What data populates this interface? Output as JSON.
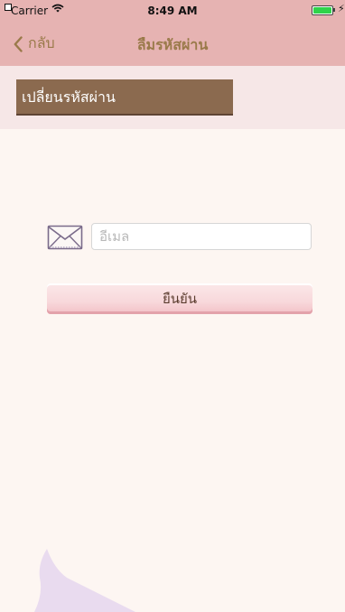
{
  "status_bar": {
    "carrier": "Carrier",
    "time": "8:49 AM"
  },
  "nav": {
    "back_label": "กลับ",
    "title": "ลืมรหัสผ่าน"
  },
  "header": {
    "section_title": "เปลี่ยนรหัสผ่าน"
  },
  "form": {
    "email_placeholder": "อีเมล",
    "email_value": "",
    "confirm_label": "ยืนยัน"
  },
  "colors": {
    "nav_bg": "#e6b3b2",
    "accent_text": "#9a7a4a",
    "title_box": "#8b6a4f",
    "page_bg": "#fdf6f2"
  },
  "icons": {
    "back": "chevron-left-icon",
    "email": "envelope-icon",
    "wifi": "wifi-icon",
    "battery": "battery-icon",
    "charging": "bolt-icon"
  }
}
